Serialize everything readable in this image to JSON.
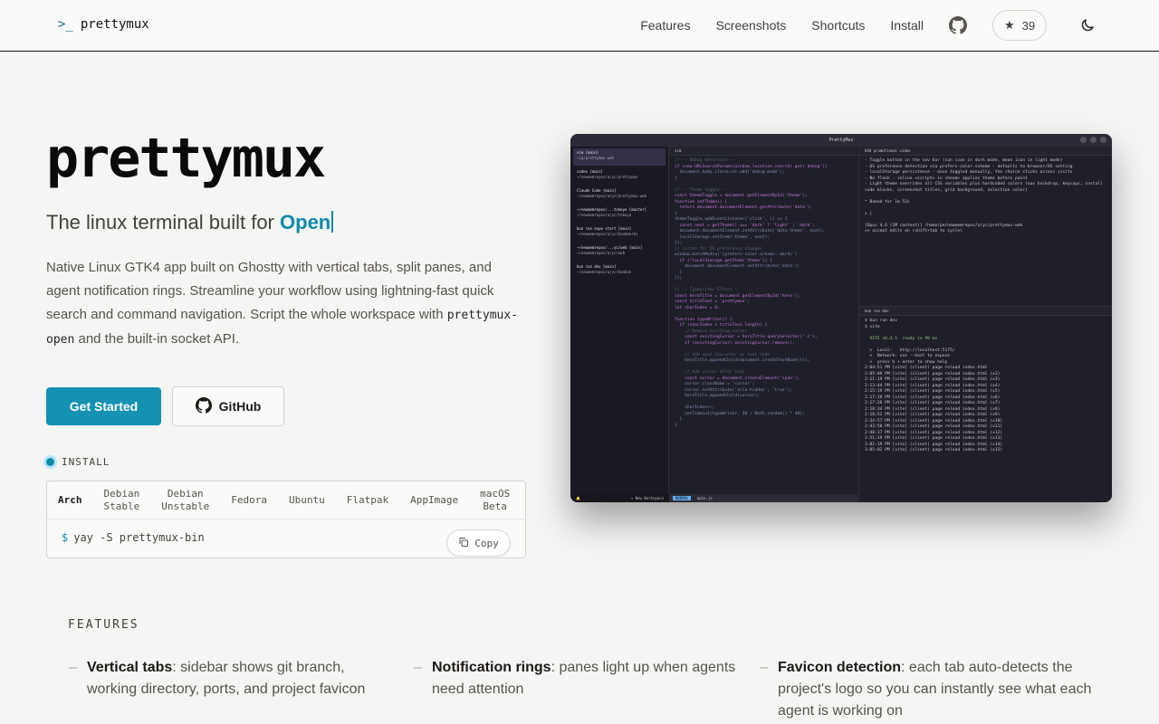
{
  "nav": {
    "logo_prompt": ">_",
    "logo_text": "prettymux",
    "links": [
      "Features",
      "Screenshots",
      "Shortcuts",
      "Install"
    ],
    "stars": "39",
    "icons": [
      "github-icon",
      "star-icon",
      "moon-icon"
    ]
  },
  "hero": {
    "title": "prettymux",
    "subtitle_prefix": "The linux terminal built for",
    "subtitle_highlight": "Open",
    "desc_part1": "Native Linux GTK4 app built on Ghostty with vertical tabs, split panes, and agent notification rings. Streamline your workflow using lightning-fast quick search and command navigation. Script the whole workspace with",
    "desc_code": "prettymux-open",
    "desc_part2": "and the built-in socket API.",
    "cta_primary": "Get Started",
    "cta_secondary": "GitHub"
  },
  "install": {
    "label": "INSTALL",
    "tabs": [
      {
        "l1": "Arch",
        "l2": ""
      },
      {
        "l1": "Debian",
        "l2": "Stable"
      },
      {
        "l1": "Debian",
        "l2": "Unstable"
      },
      {
        "l1": "Fedora",
        "l2": ""
      },
      {
        "l1": "Ubuntu",
        "l2": ""
      },
      {
        "l1": "Flatpak",
        "l2": ""
      },
      {
        "l1": "AppImage",
        "l2": ""
      },
      {
        "l1": "macOS",
        "l2": "Beta"
      }
    ],
    "active_tab": "Arch",
    "prompt": "$",
    "command": "yay -S prettymux-bin",
    "copy_label": "Copy"
  },
  "features": {
    "label": "FEATURES",
    "items": [
      {
        "title": "Vertical tabs",
        "text": ": sidebar shows git branch, working directory, ports, and project favicon"
      },
      {
        "title": "Notification rings",
        "text": ": panes light up when agents need attention"
      },
      {
        "title": "Favicon detection",
        "text": ": each tab auto-detects the project's logo so you can instantly see what each agent is working on"
      }
    ]
  },
  "screenshot": {
    "window_title": "PrettyMux",
    "sidebar_items": [
      {
        "t": "vim [main]",
        "p": "~/p/prettymux-web"
      },
      {
        "t": "codex [main]",
        "p": "~/newmemrepos/a/yc/prettymux"
      },
      {
        "t": "Claude Code [main]",
        "p": "~/newmemrepos/a/yc/prettymux-web"
      },
      {
        "t": "~/newmemrepos/...tokeyo [master]",
        "p": "~/newmemrepos/a/yc/tokeyo"
      },
      {
        "t": "bun run expo start [main]",
        "p": "~/newmemrepos/a/yc/bookmarks"
      },
      {
        "t": "~/newmemrepos/...yc/web [main]",
        "p": "~/newmemrepos/a/yc/web"
      },
      {
        "t": "bun run dev [main]",
        "p": "~/newmemrepos/a/yc/kanban"
      }
    ],
    "new_workspace": "+ New Workspace",
    "editor_tab": "vim",
    "code_lines": [
      "// -- Debug detection --",
      "if (new URLSearchParams(window.location.search).get('debug'))",
      "  document.body.classList.add('debug-mode');",
      "}",
      "",
      "// -- Theme toggle --",
      "const themeToggle = document.getElementById('theme');",
      "function setTheme() {",
      "  return document.documentElement.getAttribute('data');",
      "}",
      "themeToggle.addEventListener('click', () => {",
      "  const next = getTheme() === 'dark' ? 'light' : 'dark';",
      "  document.documentElement.setAttribute('data-theme', next);",
      "  localStorage.setItem('theme', next);",
      "});",
      "// Listen for OS preference changes",
      "window.matchMedia('(prefers-color-scheme: dark)')",
      "  if (!localStorage.getItem('theme')) {",
      "    document.documentElement.setAttribute('data');",
      "  }",
      "});",
      "",
      "// -- Typewriter Effect --",
      "const heroTitle = document.getElementById('hero');",
      "const titleText = 'prettymux';",
      "let charIndex = 0;",
      "",
      "function typeWriter() {",
      "  if (charIndex < titleText.length) {",
      "    // Remove existing cursor",
      "    const existingCursor = heroTitle.querySelector('.c');",
      "    if (existingCursor) existingCursor.remove();",
      "",
      "    // Add next character as text node",
      "    heroTitle.appendChild(document.createTextNode(t));",
      "",
      "    // Add cursor after text",
      "    const cursor = document.createElement('span');",
      "    cursor.className = 'cursor';",
      "    cursor.setAttribute('aria-hidden', 'true');",
      "    heroTitle.appendChild(cursor);",
      "",
      "    charIndex++;",
      "    setTimeout(typeWriter, 30 + Math.random() * 40);",
      "  }",
      "}"
    ],
    "status_mode": "NORMAL",
    "status_file": "main.js",
    "right_top_tab": "Add promotional video",
    "right_top_lines": [
      "- Toggle button in the nav bar (sun icon in dark mode, moon icon in light mode)",
      "- OS preference detection via prefers-color-scheme - defaults to browser/OS setting",
      "- localStorage persistence - once toggled manually, the choice sticks across visits",
      "- No flash - inline <script> in <head> applies theme before paint",
      "- Light theme overrides all CSS variables plus hardcoded colors (nav backdrop, keycaps, install code blocks, screenshot titles, grid background, selection color)",
      "",
      "* Baked for 1m 52s",
      "",
      "> |",
      "",
      "[Opus 4.6 (1M context)] /home/pe/newmemrepos/a/yc/prettymux-web",
      ">> accept edits on (shift+tab to cycle)"
    ],
    "right_bottom_tab": "bun run dev",
    "right_bottom_lines": [
      "$ bun run dev",
      "$ vite",
      "",
      "  VITE v6.4.1  ready in 99 ms",
      "",
      "  >  Local:   http://localhost:5175/",
      "  >  Network: use --host to expose",
      "  >  press h + enter to show help",
      "2:04:51 PM [vite] (client) page reload index.html",
      "2:05:09 PM [vite] (client) page reload index.html (x2)",
      "2:11:19 PM [vite] (client) page reload index.html (x3)",
      "2:13:44 PM [vite] (client) page reload index.html (x4)",
      "2:15:19 PM [vite] (client) page reload index.html (x5)",
      "2:17:18 PM [vite] (client) page reload index.html (x6)",
      "2:17:26 PM [vite] (client) page reload index.html (x7)",
      "2:18:34 PM [vite] (client) page reload index.html (x8)",
      "2:18:52 PM [vite] (client) page reload index.html (x9)",
      "2:34:57 PM [vite] (client) page reload index.html (x10)",
      "2:43:50 PM [vite] (client) page reload index.html (x11)",
      "2:48:17 PM [vite] (client) page reload index.html (x12)",
      "2:51:19 PM [vite] (client) page reload index.html (x13)",
      "3:02:19 PM [vite] (client) page reload index.html (x14)",
      "3:05:02 PM [vite] (client) page reload index.html (x15)"
    ]
  }
}
